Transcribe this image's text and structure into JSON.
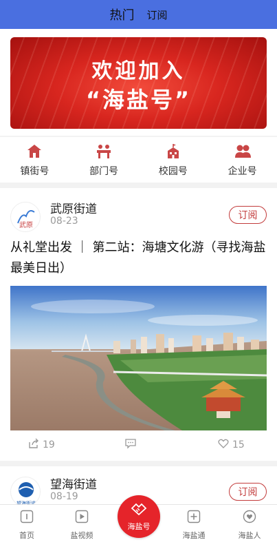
{
  "header": {
    "tabs": [
      {
        "label": "热门"
      },
      {
        "label": "订阅"
      }
    ]
  },
  "banner": {
    "line1": "欢迎加入",
    "line2": "“海盐号”"
  },
  "categories": [
    {
      "label": "镇街号",
      "icon": "house-icon"
    },
    {
      "label": "部门号",
      "icon": "office-desk-icon"
    },
    {
      "label": "校园号",
      "icon": "school-icon"
    },
    {
      "label": "企业号",
      "icon": "people-icon"
    }
  ],
  "posts": [
    {
      "account": "武原街道",
      "date": "08-23",
      "subscribe_label": "订阅",
      "title": "从礼堂出发 ｜ 第二站：海塘文化游（寻找海盐最美日出）",
      "shares": "19",
      "likes": "15",
      "avatar_text": "武原"
    },
    {
      "account": "望海街道",
      "date": "08-19",
      "subscribe_label": "订阅",
      "avatar_text": "望海街道"
    }
  ],
  "tabbar": {
    "items": [
      {
        "label": "首页",
        "icon": "home-icon"
      },
      {
        "label": "盐视频",
        "icon": "video-icon"
      },
      {
        "label": "海盐号",
        "icon": "handshake-icon"
      },
      {
        "label": "海盐通",
        "icon": "plus-box-icon"
      },
      {
        "label": "海盐人",
        "icon": "heart-bubble-icon"
      }
    ]
  },
  "colors": {
    "header": "#4a6fe0",
    "accent": "#c23b3b",
    "tab_center": "#e5242a"
  }
}
